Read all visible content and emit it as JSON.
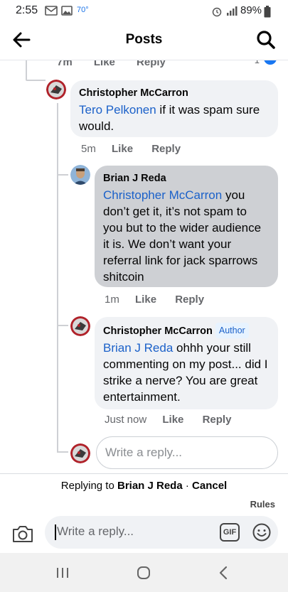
{
  "status_bar": {
    "time": "2:55",
    "temperature": "70°",
    "battery": "89%",
    "icons": [
      "gmail-icon",
      "gallery-icon",
      "alarm-icon",
      "signal-icon",
      "battery-icon"
    ]
  },
  "header": {
    "title": "Posts",
    "back_icon": "arrow-left-icon",
    "search_icon": "search-icon"
  },
  "partial_row": {
    "time": "7m",
    "like": "Like",
    "reply": "Reply",
    "reaction_count": "1"
  },
  "comments": [
    {
      "author": "Christopher McCarron",
      "mention": "Tero Pelkonen",
      "text": " if it was spam sure would.",
      "time": "5m",
      "like": "Like",
      "reply": "Reply"
    },
    {
      "author": "Brian J Reda",
      "mention": "Christopher McCarron",
      "text": " you don’t get it, it’s not spam to you but to the wider audience it is. We don’t want your referral link for jack sparrows shitcoin",
      "time": "1m",
      "like": "Like",
      "reply": "Reply"
    },
    {
      "author": "Christopher McCarron",
      "badge": "Author",
      "mention": "Brian J Reda",
      "text": " ohhh your still commenting on my post... did I strike a nerve? You are great entertainment.",
      "time": "Just now",
      "like": "Like",
      "reply": "Reply"
    }
  ],
  "inline_reply": {
    "placeholder": "Write a reply..."
  },
  "reply_bar": {
    "prefix": "Replying to ",
    "target": "Brian J Reda",
    "separator": " · ",
    "cancel": "Cancel",
    "rules": "Rules",
    "placeholder": "Write a reply...",
    "gif": "GIF"
  },
  "colors": {
    "mention": "#1b61c9",
    "bubble": "#f0f2f5",
    "highlighted_bubble": "#ced0d4",
    "meta": "#65676b"
  }
}
